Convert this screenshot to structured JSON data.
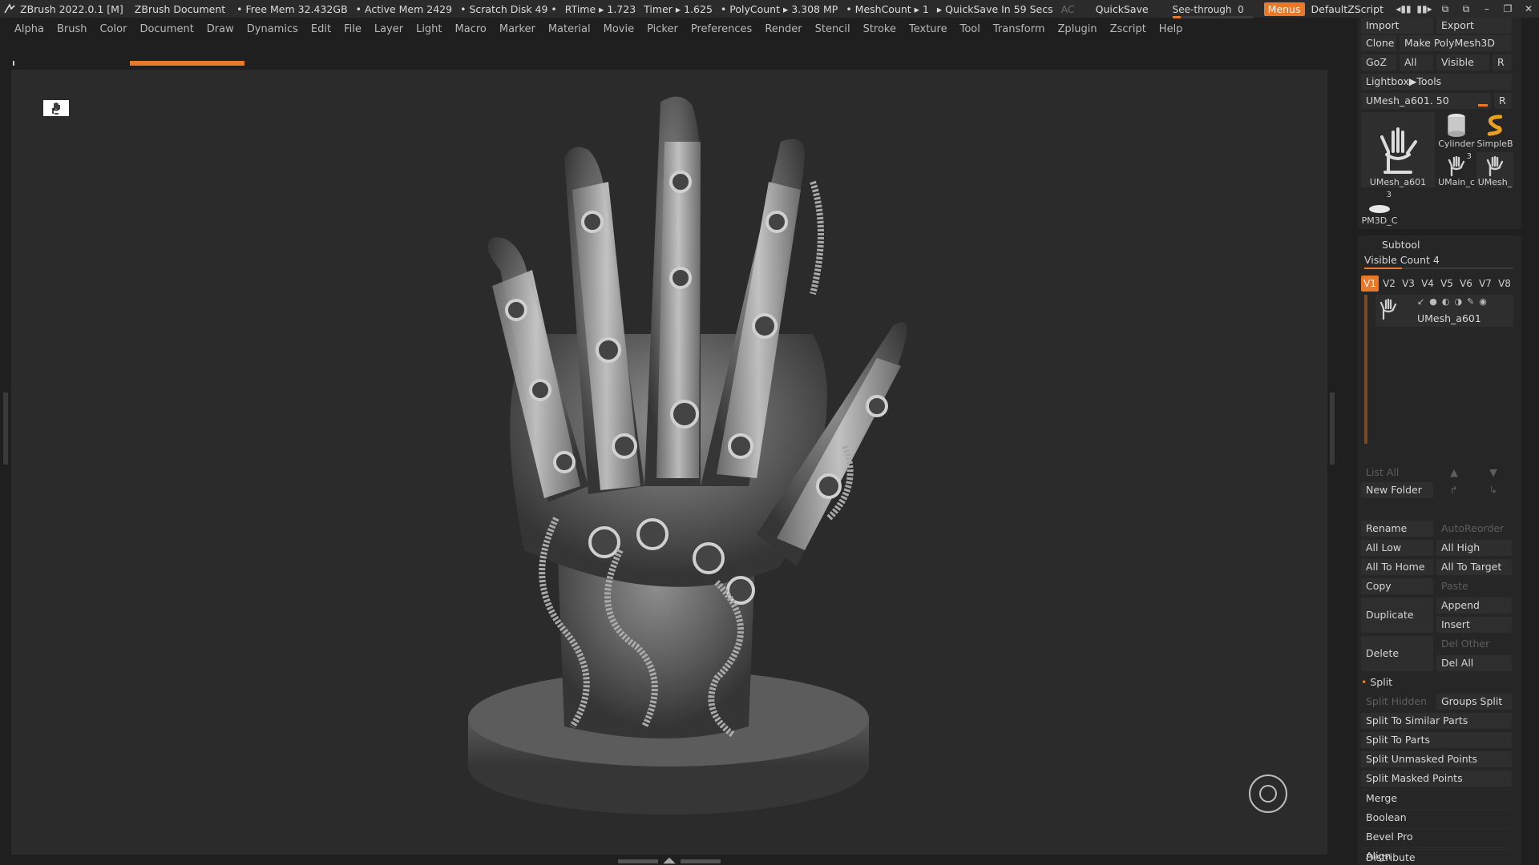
{
  "titlebar": {
    "app": "ZBrush 2022.0.1 [M]",
    "document": "ZBrush Document",
    "free_mem": "• Free Mem 32.432GB",
    "active_mem": "• Active Mem 2429",
    "scratch_disk": "• Scratch Disk 49 •",
    "rtime": "RTime ▸ 1.723",
    "timer": "Timer ▸ 1.625",
    "polycount": "• PolyCount ▸ 3.308 MP",
    "meshcount": "• MeshCount ▸ 1",
    "quicksave_timer": "▸ QuickSave In 59 Secs",
    "ac": "AC",
    "quicksave": "QuickSave",
    "see_through_label": "See-through",
    "see_through_value": "0",
    "see_through_fraction": 0.1,
    "menus": "Menus",
    "default_zscript": "DefaultZScript"
  },
  "menubar": [
    "Alpha",
    "Brush",
    "Color",
    "Document",
    "Draw",
    "Dynamics",
    "Edit",
    "File",
    "Layer",
    "Light",
    "Macro",
    "Marker",
    "Material",
    "Movie",
    "Picker",
    "Preferences",
    "Render",
    "Stencil",
    "Stroke",
    "Texture",
    "Tool",
    "Transform",
    "Zplugin",
    "Zscript",
    "Help"
  ],
  "tool_panel": {
    "import": "Import",
    "export": "Export",
    "clone": "Clone",
    "make_polymesh": "Make PolyMesh3D",
    "goz": "GoZ",
    "all": "All",
    "visible": "Visible",
    "r": "R",
    "lightbox_tools": "Lightbox▶Tools",
    "slider_name": "UMesh_a601.",
    "slider_value": "50",
    "r2": "R",
    "thumbs": [
      {
        "label": "UMesh_a601",
        "badge": ""
      },
      {
        "label": "Cylinder",
        "badge": ""
      },
      {
        "label": "SimpleB",
        "badge": ""
      },
      {
        "label": "UMain_c",
        "badge": "3"
      },
      {
        "label": "UMesh_",
        "badge": ""
      },
      {
        "label": "PM3D_C",
        "badge": "3"
      }
    ]
  },
  "subtool": {
    "title": "Subtool",
    "visible_count": "Visible Count 4",
    "visible_fraction": 0.25,
    "vtabs": [
      "V1",
      "V2",
      "V3",
      "V4",
      "V5",
      "V6",
      "V7",
      "V8"
    ],
    "item_name": "UMesh_a601",
    "list_all": "List All",
    "new_folder": "New Folder",
    "rename": "Rename",
    "autoreorder": "AutoReorder",
    "all_low": "All Low",
    "all_high": "All High",
    "all_to_home": "All To Home",
    "all_to_target": "All To Target",
    "copy": "Copy",
    "paste": "Paste",
    "duplicate": "Duplicate",
    "append": "Append",
    "insert": "Insert",
    "delete": "Delete",
    "del_other": "Del Other",
    "del_all": "Del All",
    "split": "Split",
    "split_hidden": "Split Hidden",
    "groups_split": "Groups Split",
    "split_similar": "Split To Similar Parts",
    "split_parts": "Split To Parts",
    "split_unmasked": "Split Unmasked Points",
    "split_masked": "Split Masked Points",
    "merge": "Merge",
    "boolean": "Boolean",
    "bevel_pro": "Bevel Pro",
    "align": "Align",
    "distribute": "Distribute"
  },
  "colors": {
    "accent": "#e8782a",
    "bg": "#1f1f1f",
    "canvas": "#2b2b2b"
  }
}
